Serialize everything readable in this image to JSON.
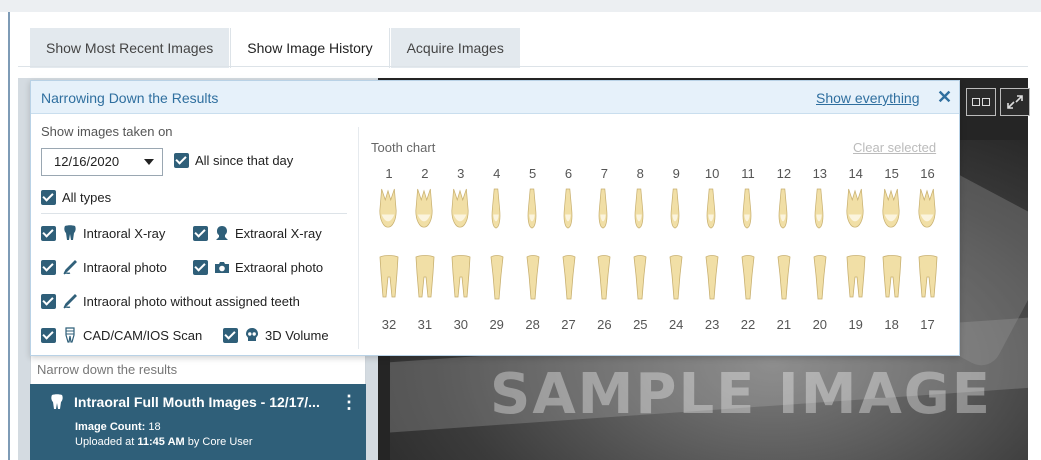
{
  "tabs": [
    {
      "label": "Show Most Recent Images",
      "active": false
    },
    {
      "label": "Show Image History",
      "active": true
    },
    {
      "label": "Acquire Images",
      "active": false
    }
  ],
  "filter": {
    "title": "Narrowing Down the Results",
    "show_everything": "Show everything",
    "close_icon": "close-icon",
    "date_caption": "Show images taken on",
    "date_value": "12/16/2020",
    "all_since_label": "All since that day",
    "all_types_label": "All types",
    "types": [
      {
        "label": "Intraoral X-ray",
        "icon": "tooth-icon",
        "checked": true
      },
      {
        "label": "Extraoral X-ray",
        "icon": "head-silhouette-icon",
        "checked": true
      },
      {
        "label": "Intraoral photo",
        "icon": "pen-icon",
        "checked": true
      },
      {
        "label": "Extraoral photo",
        "icon": "camera-icon",
        "checked": true
      },
      {
        "label": "Intraoral photo without assigned teeth",
        "icon": "pen-icon",
        "checked": true
      },
      {
        "label": "CAD/CAM/IOS Scan",
        "icon": "scanned-tooth-icon",
        "checked": true
      },
      {
        "label": "3D Volume",
        "icon": "skull-icon",
        "checked": true
      }
    ],
    "tooth_chart": {
      "title": "Tooth chart",
      "clear_label": "Clear selected",
      "upper": [
        "1",
        "2",
        "3",
        "4",
        "5",
        "6",
        "7",
        "8",
        "9",
        "10",
        "11",
        "12",
        "13",
        "14",
        "15",
        "16"
      ],
      "lower": [
        "32",
        "31",
        "30",
        "29",
        "28",
        "27",
        "26",
        "25",
        "24",
        "23",
        "22",
        "21",
        "20",
        "19",
        "18",
        "17"
      ]
    }
  },
  "results": {
    "caption": "Narrow down the results",
    "card": {
      "title": "Intraoral Full Mouth Images - 12/17/...",
      "count_label": "Image Count:",
      "count_value": "18",
      "uploaded_prefix": "Uploaded at",
      "uploaded_time": "11:45 AM",
      "uploaded_by": "by Core User"
    }
  },
  "viewer": {
    "watermark": "SAMPLE IMAGE"
  },
  "colors": {
    "accent": "#2f6f9f",
    "card": "#2f5f79",
    "header": "#e6f1fa",
    "tooth": "#f1dfa6"
  }
}
